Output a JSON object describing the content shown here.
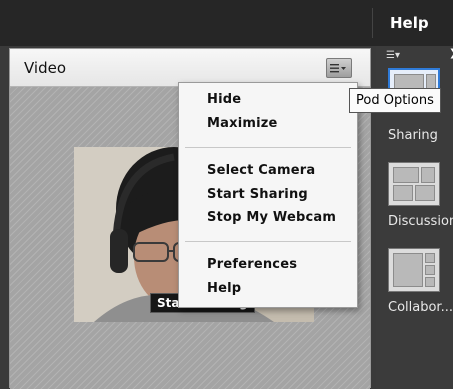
{
  "menubar": {
    "help_label": "Help"
  },
  "pod": {
    "title": "Video",
    "options_icon": "menu-lines-dropdown-icon",
    "overlay_label": "Start Sharing"
  },
  "pod_menu": {
    "items_group1": [
      "Hide",
      "Maximize"
    ],
    "items_group2": [
      "Select Camera",
      "Start Sharing",
      "Stop My Webcam"
    ],
    "items_group3": [
      "Preferences",
      "Help"
    ]
  },
  "tooltip": {
    "text": "Pod Options"
  },
  "layouts_panel": {
    "toolbar_icon": "list-menu-icon",
    "layouts": [
      {
        "label": "Sharing",
        "selected": true
      },
      {
        "label": "Discussion",
        "selected": false
      },
      {
        "label": "Collabor...",
        "selected": false
      }
    ]
  },
  "colors": {
    "menubar_bg": "#262626",
    "selection_border": "#2f7bd8",
    "pod_body_bg": "#a4a4a4"
  }
}
